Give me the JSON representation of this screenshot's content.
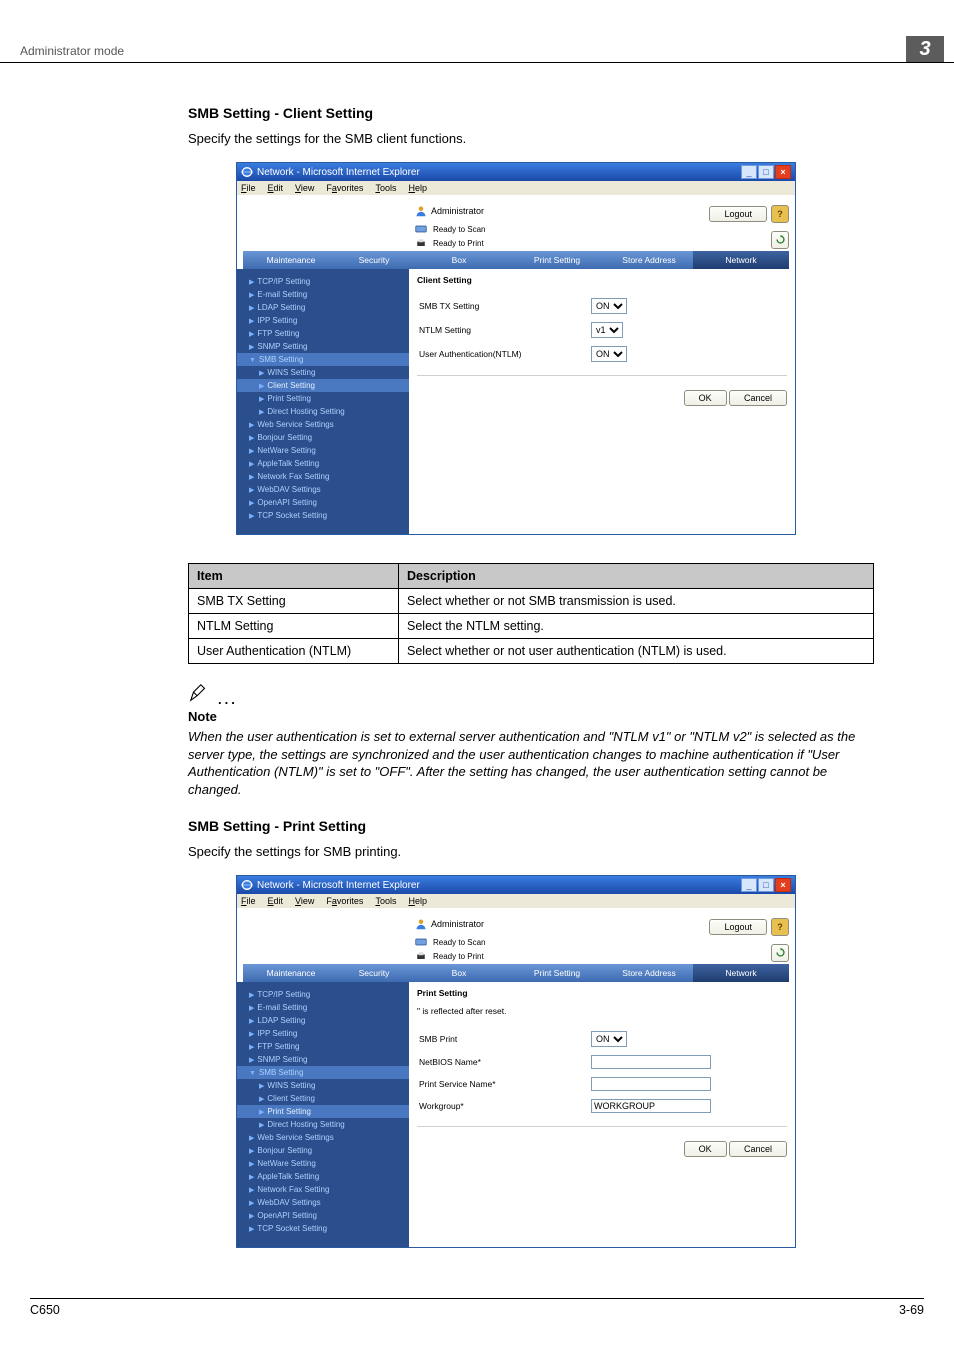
{
  "header": {
    "mode": "Administrator mode",
    "chapter": "3"
  },
  "section1": {
    "title": "SMB Setting - Client Setting",
    "intro": "Specify the settings for the SMB client functions."
  },
  "ie": {
    "window_title": "Network - Microsoft Internet Explorer",
    "menus": {
      "file": "File",
      "edit": "Edit",
      "view": "View",
      "favorites": "Favorites",
      "tools": "Tools",
      "help": "Help"
    },
    "top": {
      "admin": "Administrator",
      "status1": "Ready to Scan",
      "status2": "Ready to Print",
      "logout": "Logout"
    },
    "tabs": {
      "maintenance": "Maintenance",
      "security": "Security",
      "box": "Box",
      "print_setting": "Print Setting",
      "store_address": "Store Address",
      "network": "Network"
    },
    "nav": [
      "TCP/IP Setting",
      "E-mail Setting",
      "LDAP Setting",
      "IPP Setting",
      "FTP Setting",
      "SNMP Setting",
      "SMB Setting",
      "WINS Setting",
      "Client Setting",
      "Print Setting",
      "Direct Hosting Setting",
      "Web Service Settings",
      "Bonjour Setting",
      "NetWare Setting",
      "AppleTalk Setting",
      "Network Fax Setting",
      "WebDAV Settings",
      "OpenAPI Setting",
      "TCP Socket Setting"
    ],
    "client_setting": {
      "title": "Client Setting",
      "rows": {
        "smb_tx": "SMB TX Setting",
        "ntlm": "NTLM Setting",
        "ua": "User Authentication(NTLM)"
      },
      "values": {
        "smb_tx": "ON",
        "ntlm": "v1",
        "ua": "ON"
      },
      "ok": "OK",
      "cancel": "Cancel"
    },
    "print_setting": {
      "title": "Print Setting",
      "reflect": "\" is reflected after reset.",
      "rows": {
        "smb_print": "SMB Print",
        "netbios": "NetBIOS Name*",
        "psname": "Print Service Name*",
        "workgroup": "Workgroup*"
      },
      "values": {
        "smb_print": "ON",
        "netbios": "",
        "psname": "",
        "workgroup": "WORKGROUP"
      },
      "ok": "OK",
      "cancel": "Cancel"
    }
  },
  "spec_table": {
    "th_item": "Item",
    "th_desc": "Description",
    "rows": [
      {
        "item": "SMB TX Setting",
        "desc": "Select whether or not SMB transmission is used."
      },
      {
        "item": "NTLM Setting",
        "desc": "Select the NTLM setting."
      },
      {
        "item": "User Authentication (NTLM)",
        "desc": "Select whether or not user authentication (NTLM) is used."
      }
    ]
  },
  "note": {
    "label": "Note",
    "body": "When the user authentication is set to external server authentication and \"NTLM v1\" or \"NTLM v2\" is selected as the server type, the settings are synchronized and the user authentication changes to machine authentication if \"User Authentication (NTLM)\" is set to \"OFF\". After the setting has changed, the user authentication setting cannot be changed."
  },
  "section2": {
    "title": "SMB Setting - Print Setting",
    "intro": "Specify the settings for SMB printing."
  },
  "footer": {
    "left": "C650",
    "right": "3-69"
  }
}
